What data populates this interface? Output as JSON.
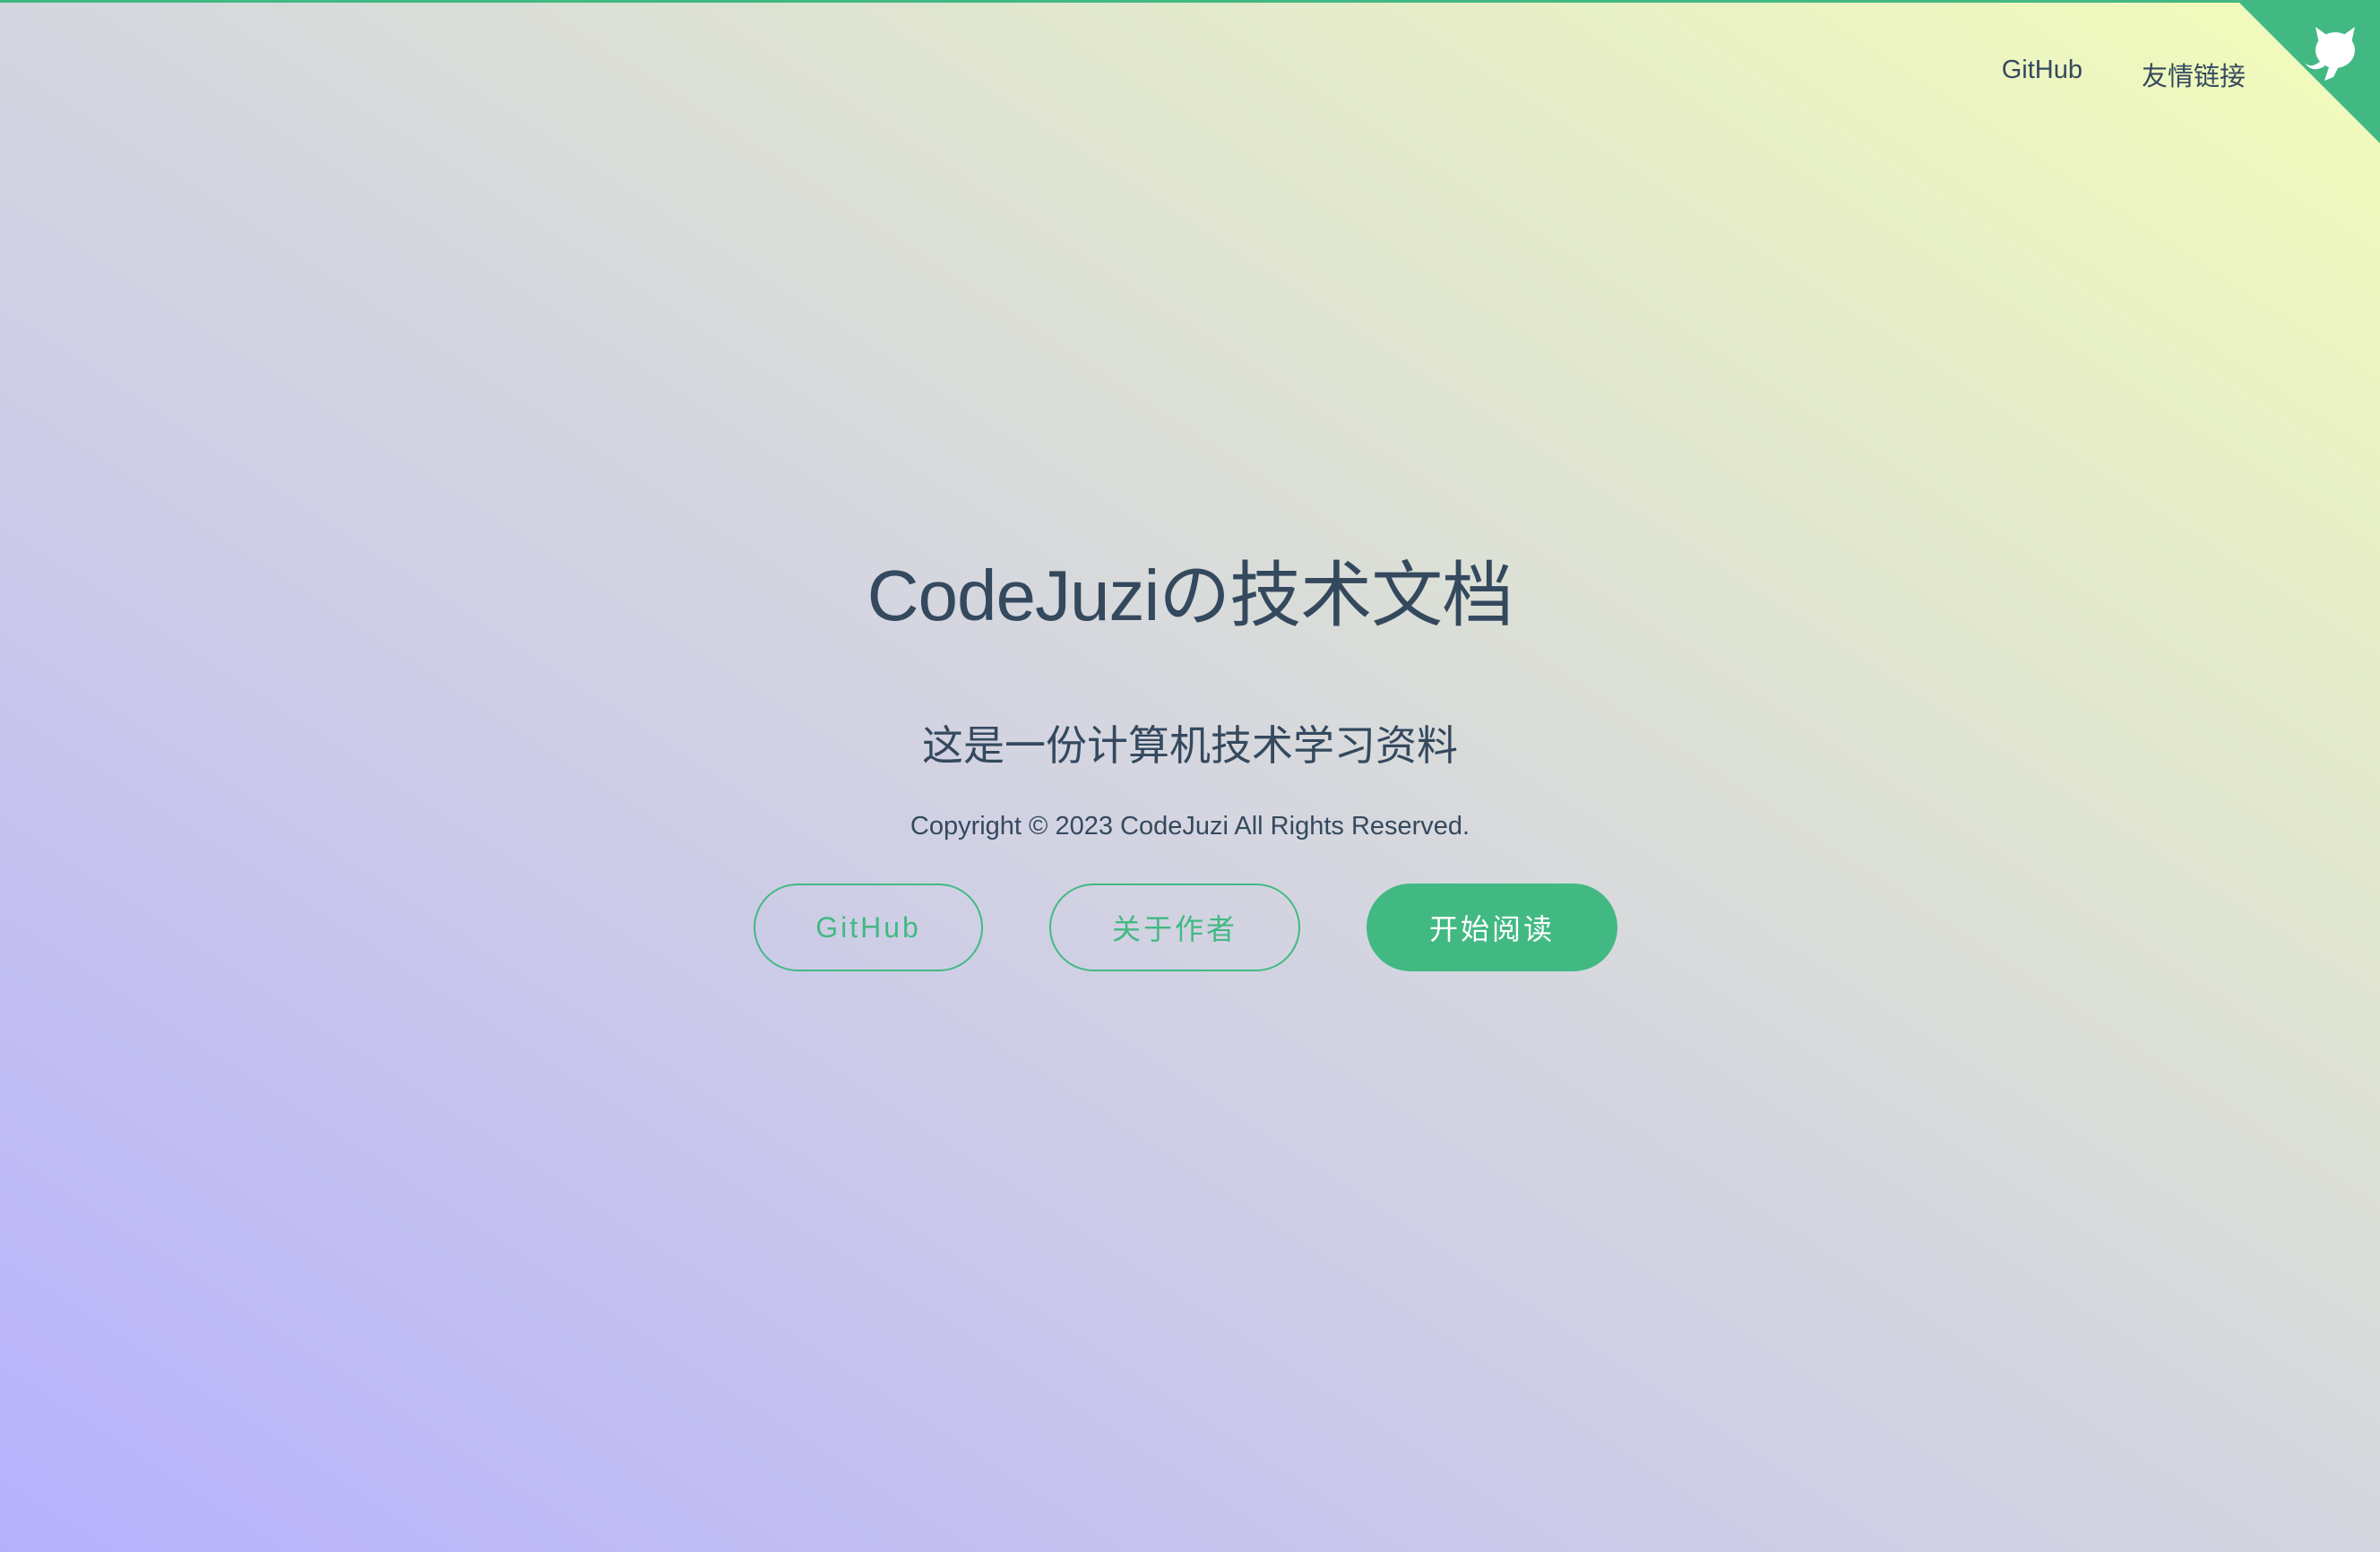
{
  "colors": {
    "accent": "#42b983",
    "text": "#34495e",
    "gradient_bottom_left": "#b7b1fd",
    "gradient_top_right": "#f2fdb9"
  },
  "nav": {
    "items": [
      {
        "label": "GitHub"
      },
      {
        "label": "友情链接"
      }
    ]
  },
  "corner": {
    "icon": "github-octocat-icon"
  },
  "cover": {
    "title": "CodeJuziの技术文档",
    "subtitle": "这是一份计算机技术学习资料",
    "copyright": "Copyright © 2023 CodeJuzi All Rights Reserved.",
    "buttons": [
      {
        "label": "GitHub"
      },
      {
        "label": "关于作者"
      },
      {
        "label": "开始阅读"
      }
    ]
  }
}
